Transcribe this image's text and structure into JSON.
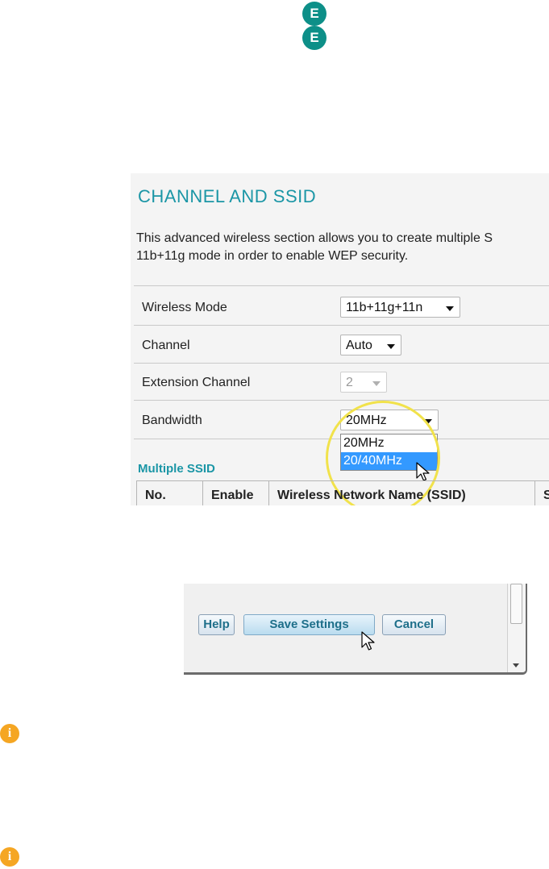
{
  "logo": {
    "letter_top": "E",
    "letter_bottom": "E",
    "color": "#0d8f88"
  },
  "panel": {
    "title": "CHANNEL AND SSID",
    "description_line1": "This advanced wireless section allows you to create multiple S",
    "description_line2": "11b+11g mode in order to enable WEP security.",
    "rows": [
      {
        "label": "Wireless Mode",
        "value": "11b+11g+11n"
      },
      {
        "label": "Channel",
        "value": "Auto"
      },
      {
        "label": "Extension Channel",
        "value": "2"
      },
      {
        "label": "Bandwidth",
        "value": "20MHz"
      }
    ],
    "bandwidth_options": [
      "20MHz",
      "20/40MHz"
    ],
    "multiple_ssid_heading": "Multiple SSID",
    "table_headers": [
      "No.",
      "Enable",
      "Wireless Network Name (SSID)",
      "S"
    ]
  },
  "actions": {
    "help_label": "Help",
    "save_label": "Save Settings",
    "cancel_label": "Cancel"
  },
  "colors": {
    "accent": "#1b96a6",
    "highlight_ring": "#f1e24b",
    "selected_option": "#3399ff",
    "info": "#f5a623"
  },
  "icons": {
    "info": "info-icon",
    "cursor": "arrow-cursor-icon"
  }
}
